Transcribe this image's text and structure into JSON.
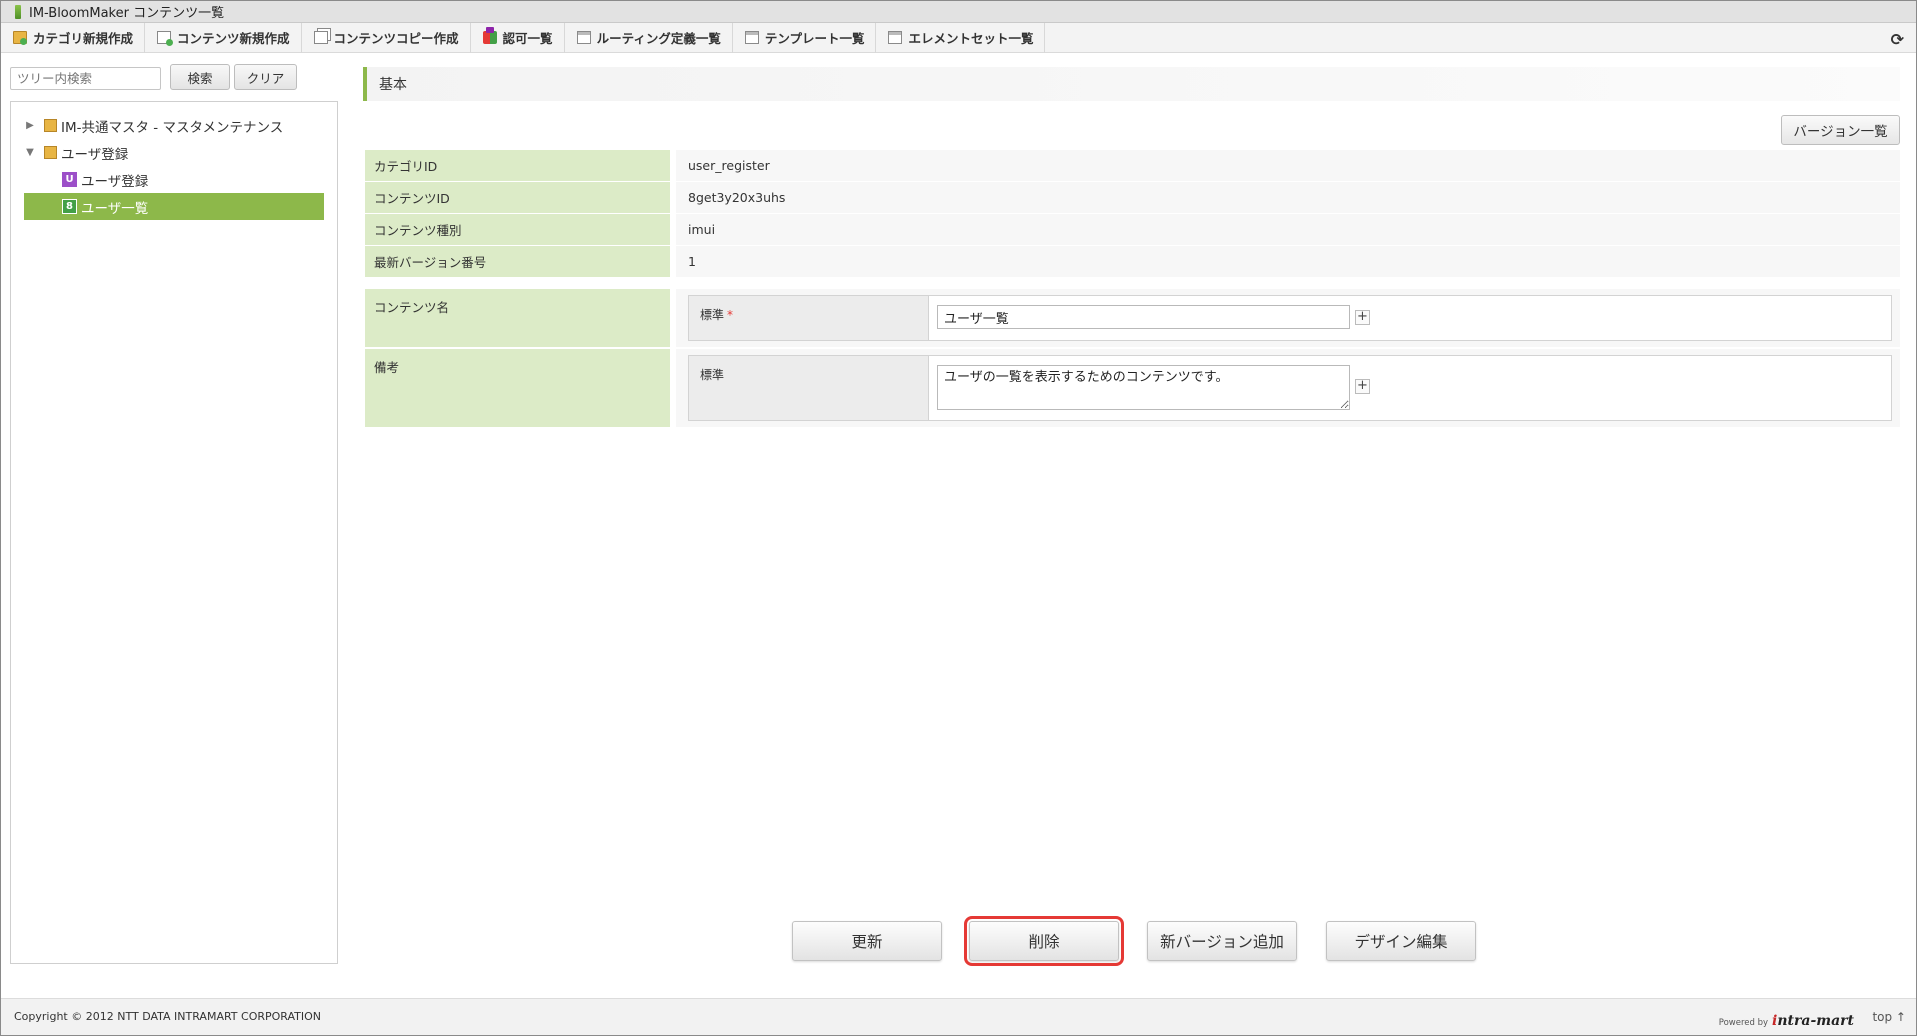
{
  "window": {
    "title": "IM-BloomMaker コンテンツ一覧"
  },
  "toolbar": {
    "items": [
      {
        "label": "カテゴリ新規作成",
        "icon": "folder-add-icon"
      },
      {
        "label": "コンテンツ新規作成",
        "icon": "page-add-icon"
      },
      {
        "label": "コンテンツコピー作成",
        "icon": "copy-icon"
      },
      {
        "label": "認可一覧",
        "icon": "authorization-icon"
      },
      {
        "label": "ルーティング定義一覧",
        "icon": "window-icon"
      },
      {
        "label": "テンプレート一覧",
        "icon": "window-icon"
      },
      {
        "label": "エレメントセット一覧",
        "icon": "window-icon"
      }
    ],
    "refresh_icon": "refresh-icon"
  },
  "sidebar": {
    "search_placeholder": "ツリー内検索",
    "search_button": "検索",
    "clear_button": "クリア",
    "tree": [
      {
        "label": "IM-共通マスタ - マスタメンテナンス",
        "toggle": "▶",
        "type": "folder"
      },
      {
        "label": "ユーザ登録",
        "toggle": "▼",
        "type": "folder"
      },
      {
        "label": "ユーザ登録",
        "badge": "U",
        "type": "content"
      },
      {
        "label": "ユーザ一覧",
        "badge": "8",
        "type": "content",
        "selected": true
      }
    ]
  },
  "main": {
    "section_title": "基本",
    "version_list_button": "バージョン一覧",
    "info": [
      {
        "label": "カテゴリID",
        "value": "user_register"
      },
      {
        "label": "コンテンツID",
        "value": "8get3y20x3uhs"
      },
      {
        "label": "コンテンツ種別",
        "value": "imui"
      },
      {
        "label": "最新バージョン番号",
        "value": "1"
      }
    ],
    "content_name": {
      "label": "コンテンツ名",
      "locale_label": "標準",
      "required_mark": "*",
      "value": "ユーザ一覧"
    },
    "remarks": {
      "label": "備考",
      "locale_label": "標準",
      "value": "ユーザの一覧を表示するためのコンテンツです。"
    },
    "add_locale_symbol": "+"
  },
  "actions": {
    "update": "更新",
    "delete": "削除",
    "add_version": "新バージョン追加",
    "design_edit": "デザイン編集"
  },
  "footer": {
    "copyright": "Copyright © 2012 NTT DATA INTRAMART CORPORATION",
    "powered_by": "Powered by",
    "brand": "intra-mart",
    "top_link": "top ↑"
  },
  "colors": {
    "accent_green": "#8db84a",
    "label_bg": "#dcebc7",
    "highlight_red": "#e53935"
  }
}
